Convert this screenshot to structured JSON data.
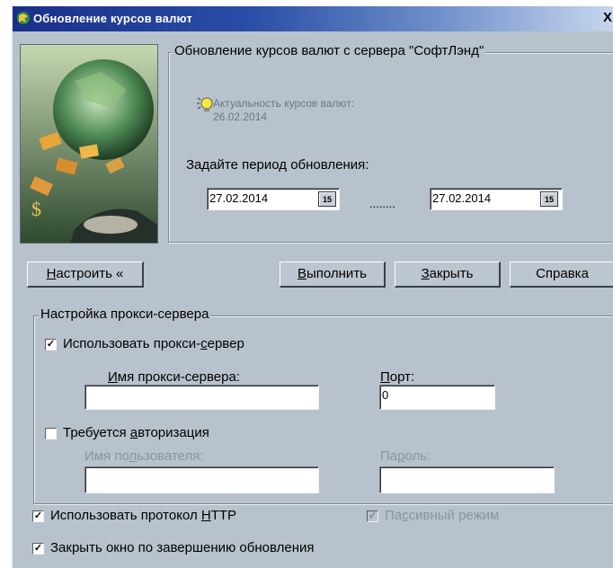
{
  "window": {
    "title": "Обновление курсов валют",
    "close_glyph": "X"
  },
  "update_group": {
    "legend": "Обновление курсов валют с сервера \"СофтЛэнд\"",
    "relevance_label": "Актуальность курсов валют:",
    "relevance_date": "26.02.2014",
    "period_label": "Задайте период обновления:",
    "date_from": "27.02.2014",
    "date_to": "27.02.2014",
    "calendar_glyph": "15",
    "separator": "........"
  },
  "buttons": {
    "settings": {
      "pre": "",
      "u": "Н",
      "post": "астроить «"
    },
    "run": {
      "pre": "",
      "u": "В",
      "post": "ыполнить"
    },
    "close": {
      "pre": "",
      "u": "З",
      "post": "акрыть"
    },
    "help": "Справка"
  },
  "proxy_group": {
    "legend": "Настройка прокси-сервера",
    "use_proxy": {
      "pre": "Использовать прокси-",
      "u": "с",
      "post": "ервер",
      "checked": true
    },
    "proxy_name": {
      "pre": "",
      "u": "И",
      "post": "мя прокси-сервера:",
      "value": ""
    },
    "port": {
      "pre": "",
      "u": "П",
      "post": "орт:",
      "value": "0"
    },
    "auth_required": {
      "pre": "Требуется ",
      "u": "а",
      "post": "вторизация",
      "checked": false
    },
    "username": {
      "pre": "Имя по",
      "u": "л",
      "post": "ьзователя:",
      "value": ""
    },
    "password": {
      "pre": "Па",
      "u": "р",
      "post": "оль:",
      "value": ""
    }
  },
  "options": {
    "use_http": {
      "pre": "Использовать протокол ",
      "u": "Н",
      "post": "ТТР",
      "checked": true
    },
    "passive_mode": {
      "pre": "Па",
      "u": "с",
      "post": "сивный режим",
      "checked": true,
      "disabled": true
    },
    "close_on_finish": {
      "text": "Закрыть окно по завершению обновления",
      "checked": true
    }
  },
  "check_glyph": "✓",
  "colors": {
    "titlebar": "#1a2f8a",
    "window_bg": "#b8c2cc",
    "disabled_text": "#8a949e"
  }
}
